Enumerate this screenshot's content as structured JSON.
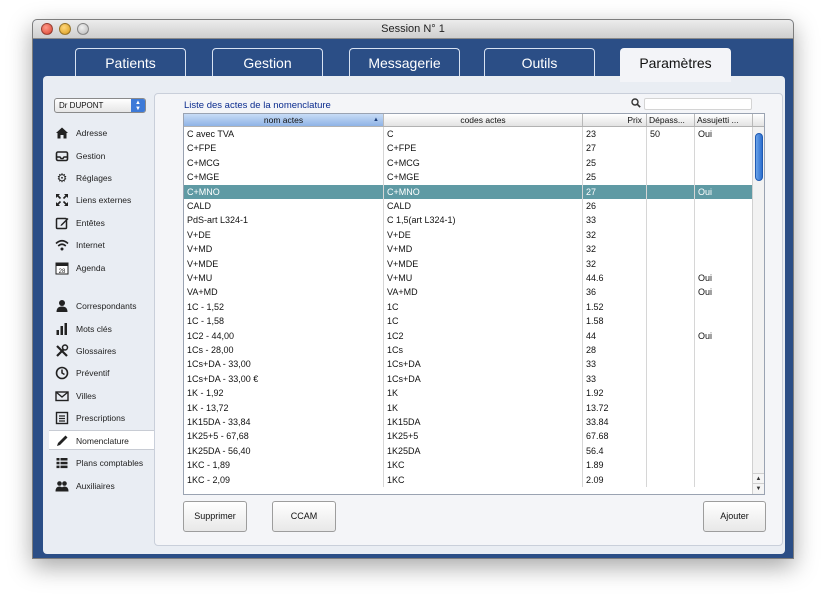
{
  "window": {
    "title": "Session N° 1"
  },
  "tabs": [
    {
      "label": "Patients",
      "active": false
    },
    {
      "label": "Gestion",
      "active": false
    },
    {
      "label": "Messagerie",
      "active": false
    },
    {
      "label": "Outils",
      "active": false
    },
    {
      "label": "Paramètres",
      "active": true
    }
  ],
  "doctor_select": {
    "value": "Dr DUPONT"
  },
  "sidebar": {
    "items": [
      {
        "label": "Adresse",
        "icon": "home-icon"
      },
      {
        "label": "Gestion",
        "icon": "tray-icon"
      },
      {
        "label": "Réglages",
        "icon": "gear-icon"
      },
      {
        "label": "Liens externes",
        "icon": "expand-icon"
      },
      {
        "label": "Entêtes",
        "icon": "edit-icon"
      },
      {
        "label": "Internet",
        "icon": "wifi-icon"
      },
      {
        "label": "Agenda",
        "icon": "calendar-icon"
      },
      {
        "label": "Correspondants",
        "icon": "person-icon"
      },
      {
        "label": "Mots clés",
        "icon": "bar-chart-icon"
      },
      {
        "label": "Glossaires",
        "icon": "tools-icon"
      },
      {
        "label": "Préventif",
        "icon": "clock-icon"
      },
      {
        "label": "Villes",
        "icon": "envelope-icon"
      },
      {
        "label": "Prescriptions",
        "icon": "list-icon"
      },
      {
        "label": "Nomenclature",
        "icon": "pencil-icon",
        "selected": true
      },
      {
        "label": "Plans comptables",
        "icon": "table-icon"
      },
      {
        "label": "Auxiliaires",
        "icon": "people-icon"
      }
    ],
    "calendar_day": "28"
  },
  "list": {
    "title": "Liste des actes de la nomenclature",
    "search_value": "",
    "columns": [
      "nom actes",
      "codes actes",
      "Prix",
      "Dépass...",
      "Assujetti ..."
    ],
    "rows": [
      [
        "C avec TVA",
        "C",
        "23",
        "50",
        "Oui"
      ],
      [
        "C+FPE",
        "C+FPE",
        "27",
        "",
        ""
      ],
      [
        "C+MCG",
        "C+MCG",
        "25",
        "",
        ""
      ],
      [
        "C+MGE",
        "C+MGE",
        "25",
        "",
        ""
      ],
      [
        "C+MNO",
        "C+MNO",
        "27",
        "",
        "Oui"
      ],
      [
        "CALD",
        "CALD",
        "26",
        "",
        ""
      ],
      [
        "PdS-art L324-1",
        "C 1,5(art L324-1)",
        "33",
        "",
        ""
      ],
      [
        "V+DE",
        "V+DE",
        "32",
        "",
        ""
      ],
      [
        "V+MD",
        "V+MD",
        "32",
        "",
        ""
      ],
      [
        "V+MDE",
        "V+MDE",
        "32",
        "",
        ""
      ],
      [
        "V+MU",
        "V+MU",
        "44.6",
        "",
        "Oui"
      ],
      [
        "VA+MD",
        "VA+MD",
        "36",
        "",
        "Oui"
      ],
      [
        "1C - 1,52",
        "1C",
        "1.52",
        "",
        ""
      ],
      [
        "1C - 1,58",
        "1C",
        "1.58",
        "",
        ""
      ],
      [
        "1C2 - 44,00",
        "1C2",
        "44",
        "",
        "Oui"
      ],
      [
        "1Cs - 28,00",
        "1Cs",
        "28",
        "",
        ""
      ],
      [
        "1Cs+DA - 33,00",
        "1Cs+DA",
        "33",
        "",
        ""
      ],
      [
        "1Cs+DA - 33,00 €",
        "1Cs+DA",
        "33",
        "",
        ""
      ],
      [
        "1K - 1,92",
        "1K",
        "1.92",
        "",
        ""
      ],
      [
        "1K - 13,72",
        "1K",
        "13.72",
        "",
        ""
      ],
      [
        "1K15DA - 33,84",
        "1K15DA",
        "33.84",
        "",
        ""
      ],
      [
        "1K25+5 - 67,68",
        "1K25+5",
        "67.68",
        "",
        ""
      ],
      [
        "1K25DA - 56,40",
        "1K25DA",
        "56.4",
        "",
        ""
      ],
      [
        "1KC - 1,89",
        "1KC",
        "1.89",
        "",
        ""
      ],
      [
        "1KC - 2,09",
        "1KC",
        "2.09",
        "",
        ""
      ]
    ],
    "selected_row": 4
  },
  "buttons": {
    "delete": "Supprimer",
    "ccam": "CCAM",
    "add": "Ajouter"
  },
  "colors": {
    "window_bg": "#2b4e86",
    "selected_row": "#5f9aa4",
    "list_title": "#0a2b8e"
  }
}
